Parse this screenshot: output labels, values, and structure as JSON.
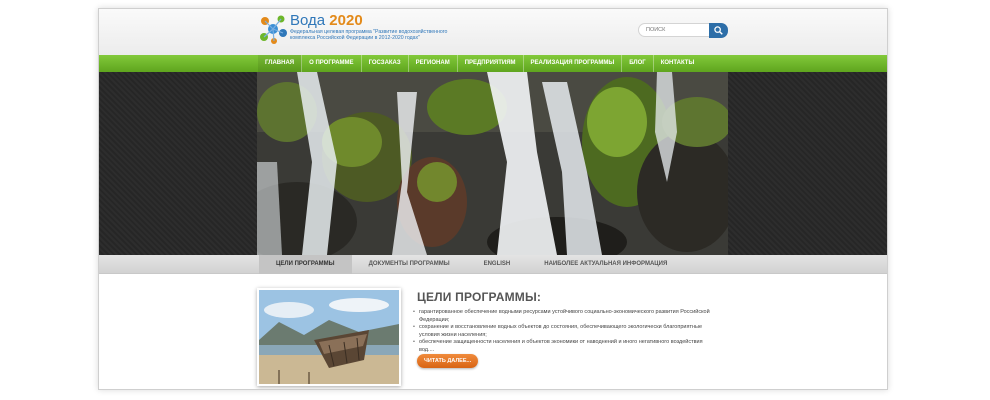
{
  "header": {
    "logo_title": "Вода",
    "logo_year": "2020",
    "logo_subtitle": "Федеральная целевая программа \"Развитие водохозяйственного комплекса Российской Федерации в 2012-2020 годах\"",
    "search_placeholder": "ПОИСК",
    "search_icon": "search-icon"
  },
  "nav": {
    "items": [
      "ГЛАВНАЯ",
      "О ПРОГРАММЕ",
      "ГОСЗАКАЗ",
      "РЕГИОНАМ",
      "ПРЕДПРИЯТИЯМ",
      "РЕАЛИЗАЦИЯ ПРОГРАММЫ",
      "БЛОГ",
      "КОНТАКТЫ"
    ]
  },
  "tabs": {
    "items": [
      "ЦЕЛИ ПРОГРАММЫ",
      "ДОКУМЕНТЫ ПРОГРАММЫ",
      "ENGLISH",
      "НАИБОЛЕЕ АКТУАЛЬНАЯ ИНФОРМАЦИЯ"
    ],
    "active_index": 0
  },
  "content": {
    "title": "ЦЕЛИ ПРОГРАММЫ:",
    "bullets": [
      "гарантированное обеспечение водными ресурсами устойчивого социально-экономического развития Российской Федерации;",
      "сохранение и восстановление водных объектов до состояния, обеспечивающего экологически благоприятные условия жизни населения;",
      "обеспечение защищенности населения и объектов экономики от наводнений и иного негативного воздействия вод...."
    ],
    "more_label": "ЧИТАТЬ ДАЛЕЕ..."
  },
  "colors": {
    "nav_green": "#6db62a",
    "logo_blue": "#2f77b9",
    "accent_orange": "#e0701f",
    "hero_band": "#262626"
  }
}
